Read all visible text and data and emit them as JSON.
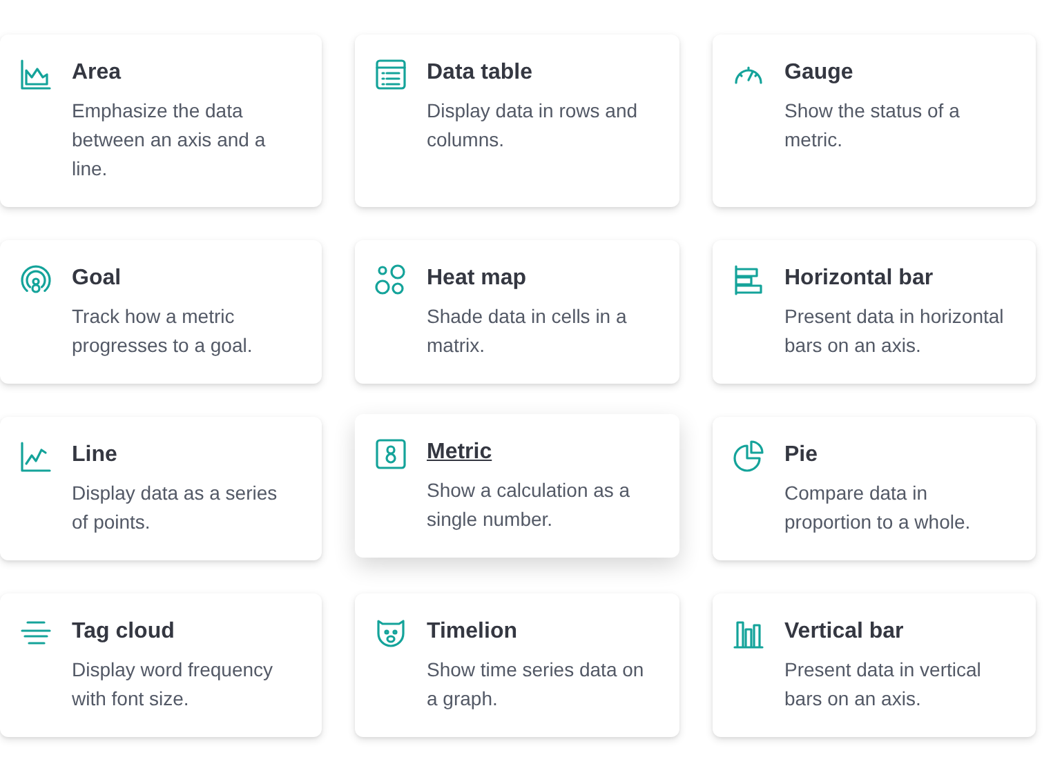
{
  "cards": [
    {
      "title": "Area",
      "description": "Emphasize the data between an axis and a line.",
      "selected": false
    },
    {
      "title": "Data table",
      "description": "Display data in rows and columns.",
      "selected": false
    },
    {
      "title": "Gauge",
      "description": "Show the status of a metric.",
      "selected": false
    },
    {
      "title": "Goal",
      "description": "Track how a metric progresses to a goal.",
      "selected": false
    },
    {
      "title": "Heat map",
      "description": "Shade data in cells in a matrix.",
      "selected": false
    },
    {
      "title": "Horizontal bar",
      "description": "Present data in horizontal bars on an axis.",
      "selected": false
    },
    {
      "title": "Line",
      "description": "Display data as a series of points.",
      "selected": false
    },
    {
      "title": "Metric",
      "description": "Show a calculation as a single number.",
      "selected": true
    },
    {
      "title": "Pie",
      "description": "Compare data in proportion to a whole.",
      "selected": false
    },
    {
      "title": "Tag cloud",
      "description": "Display word frequency with font size.",
      "selected": false
    },
    {
      "title": "Timelion",
      "description": "Show time series data on a graph.",
      "selected": false
    },
    {
      "title": "Vertical bar",
      "description": "Present data in vertical bars on an axis.",
      "selected": false
    }
  ]
}
